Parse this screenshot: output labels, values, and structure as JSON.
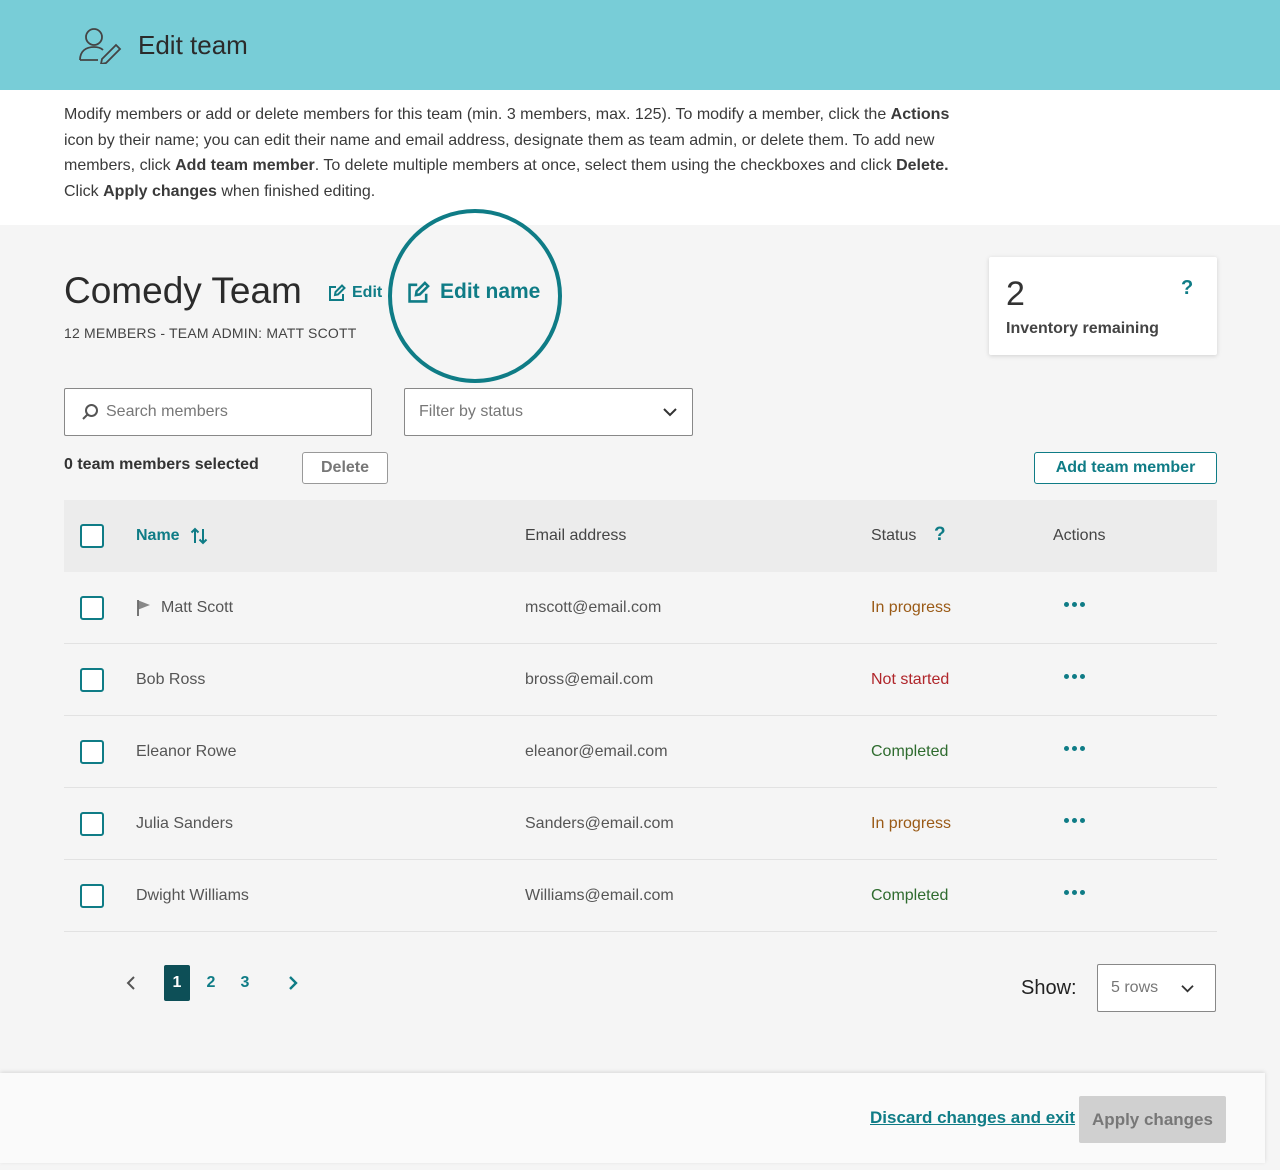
{
  "header": {
    "title": "Edit team",
    "icon": "user-edit-icon"
  },
  "intro": {
    "part1": "Modify members or add or delete members for this team (min. 3 members, max. 125). To modify a member, click the ",
    "actions_bold": "Actions",
    "part2": " icon by their name; you can edit their name and email address, designate them as team admin, or delete them. To add new members, click ",
    "add_bold": "Add team member",
    "part3": ". To delete multiple members at once, select them using the checkboxes and click ",
    "delete_bold": "Delete.",
    "part4": " Click ",
    "apply_bold": "Apply changes",
    "part5": " when finished editing."
  },
  "team": {
    "name": "Comedy Team",
    "edit_label": "Edit",
    "edit_name_label": "Edit name",
    "meta": "12 MEMBERS - TEAM ADMIN: MATT SCOTT"
  },
  "inventory": {
    "count": "2",
    "label": "Inventory remaining",
    "help": "?"
  },
  "search": {
    "placeholder": "Search members",
    "value": ""
  },
  "filter": {
    "placeholder": "Filter by status"
  },
  "selection": {
    "count_text": "0 team members selected",
    "delete_label": "Delete"
  },
  "add_member_label": "Add team member",
  "table": {
    "headers": {
      "name": "Name",
      "email": "Email address",
      "status": "Status",
      "status_help": "?",
      "actions": "Actions"
    },
    "rows": [
      {
        "name": "Matt Scott",
        "email": "mscott@email.com",
        "status": "In progress",
        "status_color": "#9a5a16",
        "admin": true
      },
      {
        "name": "Bob Ross",
        "email": "bross@email.com",
        "status": "Not started",
        "status_color": "#b0262b",
        "admin": false
      },
      {
        "name": "Eleanor Rowe",
        "email": "eleanor@email.com",
        "status": "Completed",
        "status_color": "#2e6b2e",
        "admin": false
      },
      {
        "name": "Julia Sanders",
        "email": "Sanders@email.com",
        "status": "In progress",
        "status_color": "#9a5a16",
        "admin": false
      },
      {
        "name": "Dwight Williams",
        "email": "Williams@email.com",
        "status": "Completed",
        "status_color": "#2e6b2e",
        "admin": false
      }
    ]
  },
  "pagination": {
    "pages": [
      "1",
      "2",
      "3"
    ],
    "current": "1"
  },
  "rows_per_page": {
    "label": "Show:",
    "value": "5 rows"
  },
  "footer": {
    "discard_label": "Discard changes and exit",
    "apply_label": "Apply changes"
  },
  "colors": {
    "accent": "#0f7c86",
    "header_bg": "#78cdd7",
    "active_page": "#0d4f57"
  }
}
